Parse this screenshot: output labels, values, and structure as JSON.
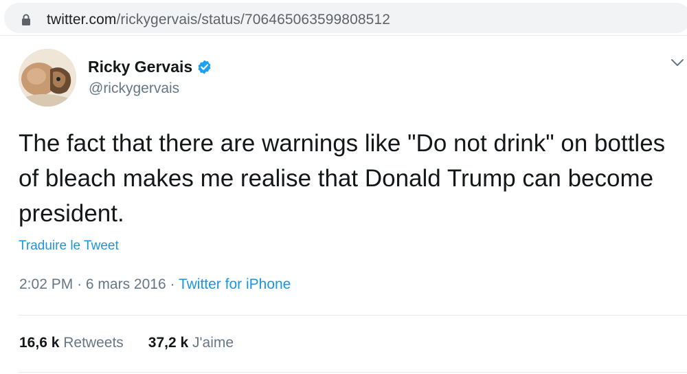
{
  "browser": {
    "url_host": "twitter.com",
    "url_path": "/rickygervais/status/706465063599808512",
    "lock_icon": "lock-icon"
  },
  "tweet": {
    "author_name": "Ricky Gervais",
    "author_handle": "@rickygervais",
    "verified_icon": "verified-badge-icon",
    "text": "The fact that there are warnings like \"Do not drink\" on bottles of bleach makes me realise that Donald Trump can become president.",
    "translate_label": "Traduire le Tweet",
    "time": "2:02 PM",
    "date": "6 mars 2016",
    "separator": "·",
    "source": "Twitter for iPhone",
    "retweets_count": "16,6 k",
    "retweets_label": "Retweets",
    "likes_count": "37,2 k",
    "likes_label": "J'aime"
  },
  "colors": {
    "link_blue": "#1b95e0",
    "text_dark": "#14171a",
    "text_gray": "#657786",
    "verified_blue": "#1da1f2"
  }
}
